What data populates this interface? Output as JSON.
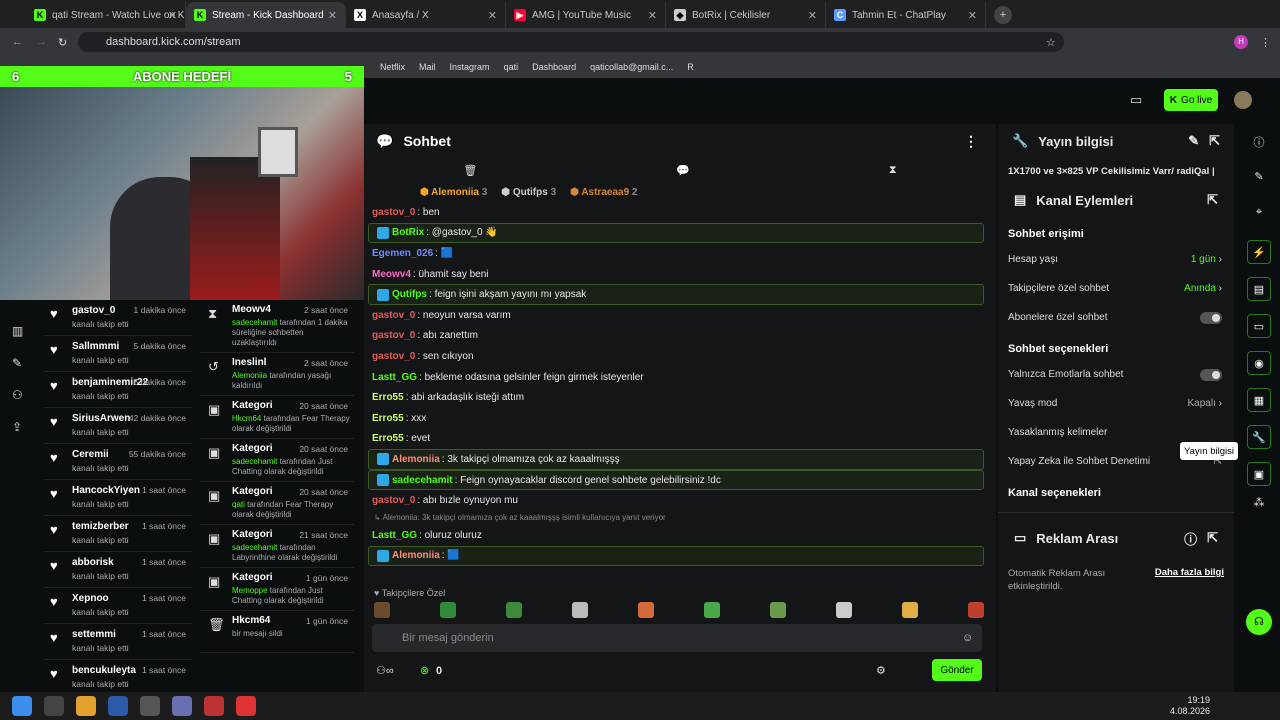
{
  "browser": {
    "tabs": [
      {
        "label": "qati Stream - Watch Live on Kick",
        "favicon_color": "#53fc18",
        "favicon_text": "K"
      },
      {
        "label": "Stream - Kick Dashboard",
        "favicon_color": "#53fc18",
        "favicon_text": "K"
      },
      {
        "label": "Anasayfa / X",
        "favicon_color": "#ffffff",
        "favicon_text": "X"
      },
      {
        "label": "AMG | YouTube Music",
        "favicon_color": "#ff0033",
        "favicon_text": "▶"
      },
      {
        "label": "BotRix | Cekilisler",
        "favicon_color": "#cccccc",
        "favicon_text": "◆"
      },
      {
        "label": "Tahmin Et - ChatPlay",
        "favicon_color": "#5b9aff",
        "favicon_text": "C"
      }
    ],
    "url": "dashboard.kick.com/stream",
    "bookmarks": [
      "Netflix",
      "Mail",
      "Instagram",
      "qati",
      "Dashboard",
      "qaticollab@gmail.c...",
      "R"
    ]
  },
  "overlay": {
    "goal_title": "ABONE HEDEFİ",
    "goal_left": "6",
    "goal_right": "5"
  },
  "header": {
    "go_live": "Go live"
  },
  "follows": [
    {
      "name": "gastov_0",
      "time": "1 dakika önce",
      "sub": "kanalı takip etti"
    },
    {
      "name": "Sallmmmi",
      "time": "5 dakika önce",
      "sub": "kanalı takip etti"
    },
    {
      "name": "benjaminemir22",
      "time": "6 dakika önce",
      "sub": "kanalı takip etti"
    },
    {
      "name": "SiriusArwen",
      "time": "42 dakika önce",
      "sub": "kanalı takip etti"
    },
    {
      "name": "Ceremii",
      "time": "55 dakika önce",
      "sub": "kanalı takip etti"
    },
    {
      "name": "HancockYiyen",
      "time": "1 saat önce",
      "sub": "kanalı takip etti"
    },
    {
      "name": "temizberber",
      "time": "1 saat önce",
      "sub": "kanalı takip etti"
    },
    {
      "name": "abborisk",
      "time": "1 saat önce",
      "sub": "kanalı takip etti"
    },
    {
      "name": "Xepnoo",
      "time": "1 saat önce",
      "sub": "kanalı takip etti"
    },
    {
      "name": "settemmi",
      "time": "1 saat önce",
      "sub": "kanalı takip etti"
    },
    {
      "name": "bencukuleyta",
      "time": "1 saat önce",
      "sub": "kanalı takip etti"
    }
  ],
  "events": [
    {
      "icon": "⧗",
      "name": "Meowv4",
      "time": "2 saat önce",
      "d1": "sadecehamit",
      "d2": " tarafından 1 dakika süreliğine sohbetten uzaklaştırıldı"
    },
    {
      "icon": "↺",
      "name": "Ineslinl",
      "time": "2 saat önce",
      "d1": "Alemoniia",
      "d2": " tarafından yasağı kaldırıldı"
    },
    {
      "icon": "▣",
      "name": "Kategori",
      "time": "20 saat önce",
      "d1": "Hkcm64",
      "d2": " tarafından Fear Therapy olarak değiştirildi"
    },
    {
      "icon": "▣",
      "name": "Kategori",
      "time": "20 saat önce",
      "d1": "sadecehamit",
      "d2": " tarafından Just Chatting olarak değiştirildi"
    },
    {
      "icon": "▣",
      "name": "Kategori",
      "time": "20 saat önce",
      "d1": "qati",
      "d2": " tarafından Fear Therapy olarak değiştirildi"
    },
    {
      "icon": "▣",
      "name": "Kategori",
      "time": "21 saat önce",
      "d1": "sadecehamit",
      "d2": " tarafından Labyrinthine olarak değiştirildi"
    },
    {
      "icon": "▣",
      "name": "Kategori",
      "time": "1 gün önce",
      "d1": "Memoppe",
      "d2": " tarafından Just Chatting olarak değiştirildi"
    },
    {
      "icon": "🗑",
      "name": "Hkcm64",
      "time": "1 gün önce",
      "d1": "",
      "d2": "bir mesajı sildi"
    }
  ],
  "chat": {
    "title": "Sohbet",
    "top": [
      {
        "name": "Alemoniia",
        "count": "3",
        "color": "#f5a623"
      },
      {
        "name": "Qutifps",
        "count": "3",
        "color": "#cccccc"
      },
      {
        "name": "Astraeaa9",
        "count": "2",
        "color": "#d4883a"
      }
    ],
    "messages": [
      {
        "user": "gastov_0",
        "color": "#e05a5a",
        "text": "ben",
        "hl": false
      },
      {
        "user": "BotRix",
        "color": "#53fc18",
        "text": "@gastov_0 👋",
        "hl": true
      },
      {
        "user": "Egemen_026",
        "color": "#6e8cff",
        "text": "🟦",
        "hl": false
      },
      {
        "user": "Meowv4",
        "color": "#ff66cc",
        "text": "ühamit say beni",
        "hl": false
      },
      {
        "user": "Qutifps",
        "color": "#53fc18",
        "text": "feign işini akşam yayını mı yapsak",
        "hl": true
      },
      {
        "user": "gastov_0",
        "color": "#e05a5a",
        "text": "neoyun varsa varım",
        "hl": false
      },
      {
        "user": "gastov_0",
        "color": "#e05a5a",
        "text": "abı zanettım",
        "hl": false
      },
      {
        "user": "gastov_0",
        "color": "#e05a5a",
        "text": "sen cıkıyon",
        "hl": false
      },
      {
        "user": "Lastt_GG",
        "color": "#53fc18",
        "text": "bekleme odasına gelsinler feign girmek isteyenler",
        "hl": false
      },
      {
        "user": "Erro55",
        "color": "#c8ff66",
        "text": "abi arkadaşlık isteği attım",
        "hl": false
      },
      {
        "user": "Erro55",
        "color": "#c8ff66",
        "text": "xxx",
        "hl": false
      },
      {
        "user": "Erro55",
        "color": "#c8ff66",
        "text": "evet",
        "hl": false
      },
      {
        "user": "Alemoniia",
        "color": "#ff8a80",
        "text": "3k takipçi olmamıza çok az kaaalmışşş",
        "hl": true
      },
      {
        "user": "sadecehamit",
        "color": "#53fc18",
        "text": "Feign oynayacaklar discord genel sohbete gelebilirsiniz !dc",
        "hl": true
      },
      {
        "user": "gastov_0",
        "color": "#e05a5a",
        "text": "abı bızle oynuyon mu",
        "hl": false
      }
    ],
    "reply_note": "Alemoniia: 3k takipçi olmamıza çok az kaaalmışşş isimli kullanıcıya yanıt veriyor",
    "after": [
      {
        "user": "Lastt_GG",
        "color": "#53fc18",
        "text": "oluruz oluruz",
        "hl": false
      },
      {
        "user": "Alemoniia",
        "color": "#ff8a80",
        "text": "🟦",
        "hl": true
      }
    ],
    "emote_label": "Takipçilere Özel",
    "input_placeholder": "Bir mesaj gönderin",
    "points": "0",
    "send": "Gönder"
  },
  "panel": {
    "stream_info_title": "Yayın bilgisi",
    "stream_title": "1X1700 ve 3×825 VP Cekilisimiz Varr/ radiQal |",
    "actions_title": "Kanal Eylemleri",
    "chat_access": "Sohbet erişimi",
    "account_age": "Hesap yaşı",
    "account_age_val": "1 gün",
    "followers_only": "Takipçilere özel sohbet",
    "followers_only_val": "Anında",
    "subs_only": "Abonelere özel sohbet",
    "chat_options": "Sohbet seçenekleri",
    "emotes_only": "Yalnızca Emotlarla sohbet",
    "slow_mode": "Yavaş mod",
    "slow_mode_val": "Kapalı",
    "banned_words": "Yasaklanmış kelimeler",
    "ai_moderation": "Yapay Zeka ile Sohbet Denetimi",
    "channel_options": "Kanal seçenekleri",
    "ad_title": "Reklam Arası",
    "ad_desc": "Otomatik Reklam Arası etkinleştirildi.",
    "ad_more": "Daha fazla bilgi",
    "tooltip": "Yayın bilgisi"
  },
  "taskbar": {
    "time": "19:19",
    "date": "4.08.2026"
  }
}
